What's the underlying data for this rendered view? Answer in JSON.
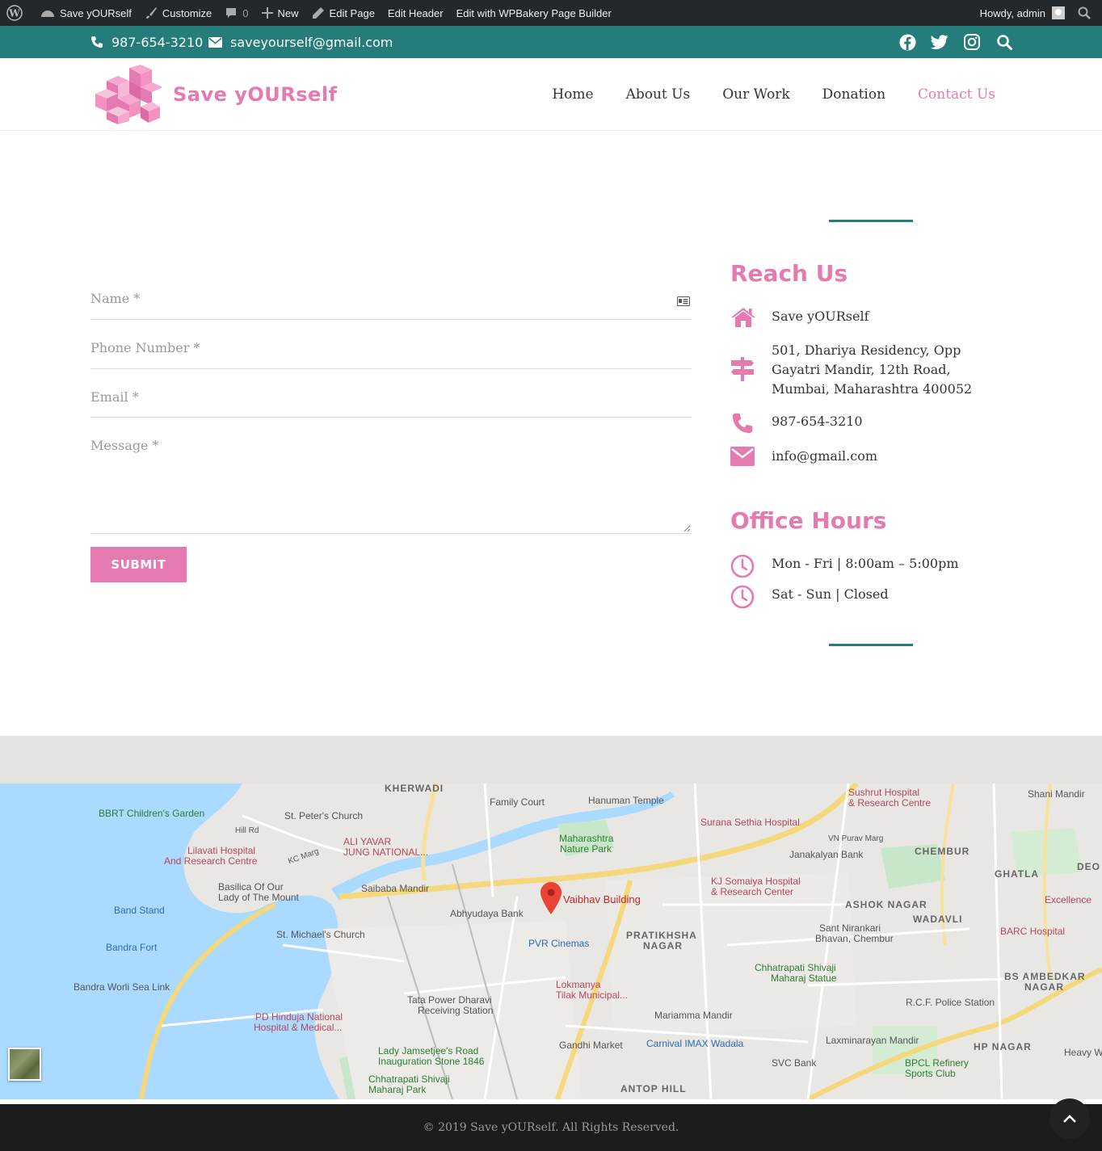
{
  "admin_bar": {
    "site_name": "Save yOURself",
    "customize": "Customize",
    "comments_count": "0",
    "new": "New",
    "edit_page": "Edit Page",
    "edit_header": "Edit Header",
    "edit_wpbakery": "Edit with WPBakery Page Builder",
    "howdy": "Howdy, admin"
  },
  "topbar": {
    "phone": "987-654-3210",
    "email": "saveyourself@gmail.com",
    "social_icons": [
      "facebook-icon",
      "twitter-icon",
      "instagram-icon",
      "search-icon"
    ],
    "bg_color": "#247c7b"
  },
  "header": {
    "logo_text": "Save yOURself",
    "nav": [
      "Home",
      "About Us",
      "Our Work",
      "Donation",
      "Contact Us"
    ],
    "active_nav": "Contact Us",
    "accent_color": "#e57ab1"
  },
  "form": {
    "name_placeholder": "Name *",
    "phone_placeholder": "Phone Number *",
    "email_placeholder": "Email *",
    "message_placeholder": "Message *",
    "submit_label": "SUBMIT"
  },
  "sidebar": {
    "reach_title": "Reach Us",
    "org_name": "Save yOURself",
    "address": "501, Dhariya Residency, Opp Gayatri Mandir, 12th Road, Mumbai, Maharashtra 400052",
    "phone": "987-654-3210",
    "email": "info@gmail.com",
    "hours_title": "Office Hours",
    "hours_weekday": "Mon - Fri | 8:00am – 5:00pm",
    "hours_weekend": "Sat - Sun | Closed"
  },
  "map": {
    "marker_label": "Vaibhav Building",
    "labels": {
      "kherwadi": "KHERWADI",
      "bbrt": "BBRT Children's Garden",
      "st_peter": "St. Peter's Church",
      "family_court": "Family Court",
      "hanuman": "Hanuman Temple",
      "sushrut": "Sushrut Hospital",
      "sushrut2": "& Research Centre",
      "shani": "Shani Mandir",
      "surana": "Surana Sethia Hospital",
      "lilavati": "Lilavati Hospital",
      "lilavati2": "And Research Centre",
      "ali_yavar": "ALI YAVAR",
      "ali_yavar2": "JUNG NATIONAL...",
      "mnp": "Maharashtra",
      "mnp2": "Nature Park",
      "janakalyan": "Janakalyan Bank",
      "chembur": "CHEMBUR",
      "ghatla": "GHATLA",
      "basilica": "Basilica Of Our",
      "basilica2": "Lady of The Mount",
      "saibaba": "Saibaba Mandir",
      "kj": "KJ Somaiya Hospital",
      "kj2": "& Research Center",
      "ashok": "ASHOK NAGAR",
      "excellence": "Excellence",
      "band_stand": "Band Stand",
      "abhyudaya": "Abhyudaya Bank",
      "wadavli": "WADAVLI",
      "nirankari": "Sant Nirankari",
      "nirankari2": "Bhavan, Chembur",
      "barc": "BARC Hospital",
      "bandra_fort": "Bandra Fort",
      "st_michael": "St. Michael's Church",
      "pvr": "PVR Cinemas",
      "pratikhsha": "PRATIKHSHA",
      "nagar": "NAGAR",
      "shivaji_statue": "Chhatrapati Shivaji",
      "shivaji_statue2": "Maharaj Statue",
      "sea_link": "Bandra Worli Sea Link",
      "tata": "Tata Power Dharavi",
      "tata2": "Receiving Station",
      "lokmanya": "Lokmanya",
      "lokmanya2": "Tilak Municipal...",
      "mariamma": "Mariamma Mandir",
      "bs_ambedkar": "BS AMBEDKAR",
      "bs_nagar": "NAGAR",
      "rcf": "R.C.F. Police Station",
      "hinduja": "PD Hinduja National",
      "hinduja2": "Hospital & Medical...",
      "lady_j": "Lady Jamsetjee's Road",
      "lady_j2": "Inauguration Stone 1846",
      "gandhi": "Gandhi Market",
      "imax": "Carnival IMAX Wadala",
      "laxmi": "Laxminarayan Mandir",
      "hp_nagar": "HP NAGAR",
      "heavy": "Heavy W",
      "shivaji_park": "Chhatrapati Shivaji",
      "shivaji_park2": "Maharaj Park",
      "svc": "SVC Bank",
      "bpcl": "BPCL Refinery",
      "bpcl2": "Sports Club",
      "antop": "ANTOP HILL",
      "hill_rd": "Hill Rd",
      "kc_marg": "KC Marg",
      "vn_purav": "VN Purav Marg",
      "deo": "DEO"
    }
  },
  "footer": {
    "copyright": "© 2019 Save yOURself. All Rights Reserved."
  }
}
